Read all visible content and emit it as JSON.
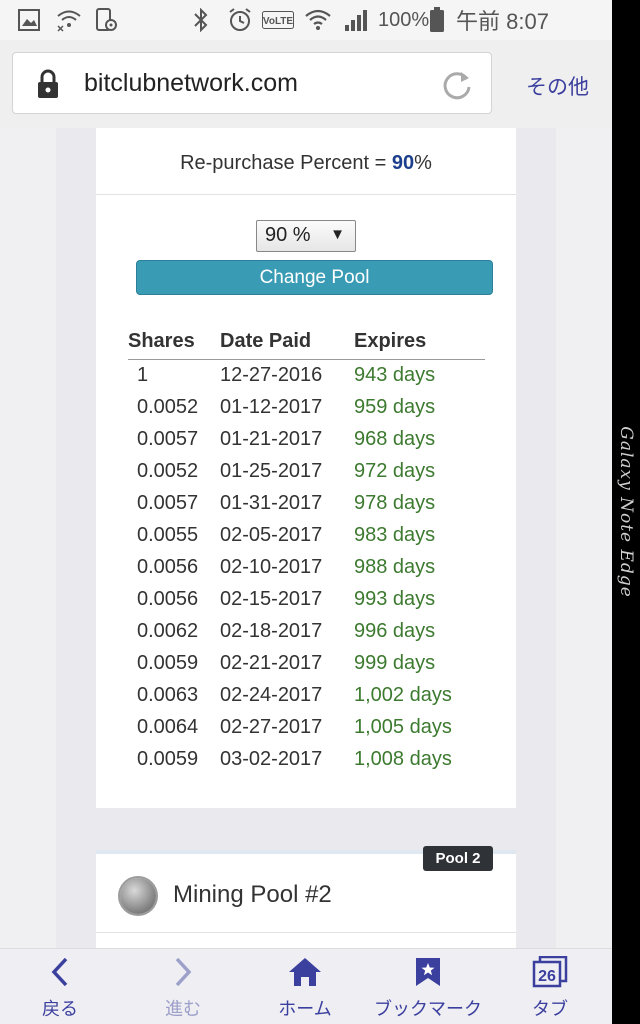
{
  "status_bar": {
    "battery_percent": "100%",
    "time": "午前 8:07",
    "volte_label": "VoLTE",
    "icons": [
      "gallery-icon",
      "wifi-x-icon",
      "device-settings-icon",
      "bluetooth-icon",
      "alarm-icon",
      "volte-icon",
      "wifi-icon",
      "signal-icon",
      "battery-icon"
    ]
  },
  "device": {
    "edge_label": "Galaxy Note Edge"
  },
  "browser": {
    "url": "bitclubnetwork.com",
    "menu_label": "その他"
  },
  "pool1": {
    "repurchase_label": "Re-purchase Percent = ",
    "repurchase_value": "90",
    "repurchase_suffix": "%",
    "select_value": "90 %",
    "change_button": "Change Pool",
    "table": {
      "headers": [
        "Shares",
        "Date Paid",
        "Expires"
      ],
      "rows": [
        [
          "1",
          "12-27-2016",
          "943 days"
        ],
        [
          "0.0052",
          "01-12-2017",
          "959 days"
        ],
        [
          "0.0057",
          "01-21-2017",
          "968 days"
        ],
        [
          "0.0052",
          "01-25-2017",
          "972 days"
        ],
        [
          "0.0057",
          "01-31-2017",
          "978 days"
        ],
        [
          "0.0055",
          "02-05-2017",
          "983 days"
        ],
        [
          "0.0056",
          "02-10-2017",
          "988 days"
        ],
        [
          "0.0056",
          "02-15-2017",
          "993 days"
        ],
        [
          "0.0062",
          "02-18-2017",
          "996 days"
        ],
        [
          "0.0059",
          "02-21-2017",
          "999 days"
        ],
        [
          "0.0063",
          "02-24-2017",
          "1,002 days"
        ],
        [
          "0.0064",
          "02-27-2017",
          "1,005 days"
        ],
        [
          "0.0059",
          "03-02-2017",
          "1,008 days"
        ]
      ]
    }
  },
  "pool2": {
    "badge": "Pool 2",
    "title": "Mining Pool #2"
  },
  "bottom_nav": {
    "back": "戻る",
    "forward": "進む",
    "home": "ホーム",
    "bookmarks": "ブックマーク",
    "tabs": "タブ",
    "tab_count": "26"
  },
  "colors": {
    "accent": "#3b3f9e",
    "button": "#3a9bb5",
    "expires": "#3c7a2f",
    "repurchase_value": "#1b3f8c"
  }
}
